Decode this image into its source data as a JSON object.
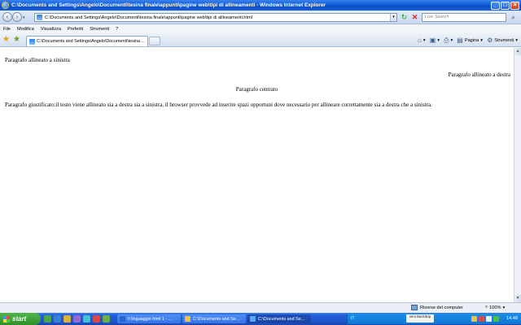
{
  "window": {
    "title": "C:\\Documents and Settings\\Angelo\\Documenti\\tesina finale\\appunti\\pagine web\\tipi di allineamenti - Windows Internet Explorer",
    "minimize": "_",
    "maximize": "□",
    "close": "×"
  },
  "address": {
    "url": "C:\\Documents and Settings\\Angelo\\Documenti\\tesina finale\\appunti\\pagine web\\tipi di allineamenti.html",
    "search_placeholder": "Live Search"
  },
  "menu": [
    "File",
    "Modifica",
    "Visualizza",
    "Preferiti",
    "Strumenti",
    "?"
  ],
  "tab": {
    "label": "C:\\Documents and Settings\\Angelo\\Documenti\\tesina ..."
  },
  "commands": {
    "page": "Pagina",
    "tools": "Strumenti"
  },
  "content": {
    "left": "Paragrafo allineato a sinistra",
    "right": "Paragrafo allineato a destra",
    "center": "Paragrafo centrato",
    "justify": "Paragrafo giustificato:il testo viene allineato sia a destra sia a sinistra, il browser provvede ad inserire spazi opportuni dove necessario per allineare correttamente sia a destra che a sinistra."
  },
  "status": {
    "zone": "Risorse del computer",
    "zoom": "100%"
  },
  "taskbar": {
    "start": "start",
    "tasks": [
      "Il linguaggio html 1 - ...",
      "C:\\Documents and Se...",
      "C:\\Documents and Se..."
    ],
    "tray_lang": "IT",
    "antivirus": "nero BackItUp",
    "clock": "14.48"
  },
  "colors": {
    "titlebar": "#1460d8",
    "taskbar": "#245edb",
    "start": "#3a9a35"
  }
}
